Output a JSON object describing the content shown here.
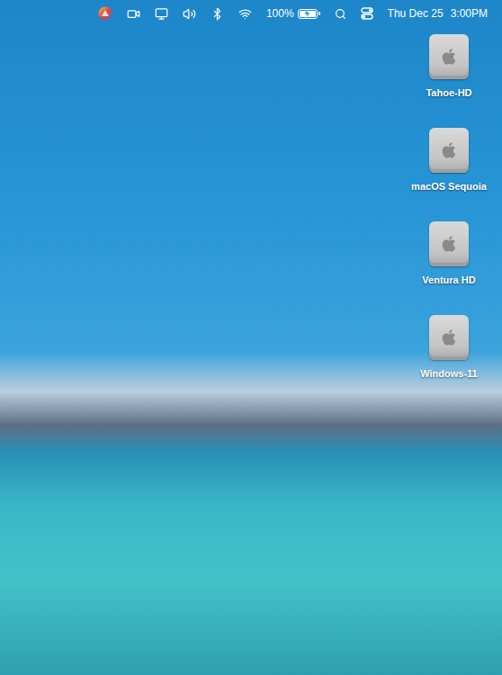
{
  "menu_bar": {
    "items": [
      {
        "kind": "app"
      },
      {
        "kind": "screen-record"
      },
      {
        "kind": "display"
      },
      {
        "kind": "volume"
      },
      {
        "kind": "bluetooth"
      },
      {
        "kind": "wifi"
      },
      {
        "kind": "battery",
        "text": "100%",
        "level": 1,
        "charging": true
      },
      {
        "kind": "search"
      },
      {
        "kind": "control-center"
      },
      {
        "kind": "clock",
        "date": "Thu Dec 25",
        "time": "3:00PM"
      }
    ]
  },
  "desktop": {
    "icons": [
      {
        "label": "Tahoe-HD",
        "selected": false
      },
      {
        "label": "macOS Sequoia",
        "selected": false
      },
      {
        "label": "Ventura HD",
        "selected": false
      },
      {
        "label": "Windows-11",
        "selected": false
      }
    ]
  }
}
